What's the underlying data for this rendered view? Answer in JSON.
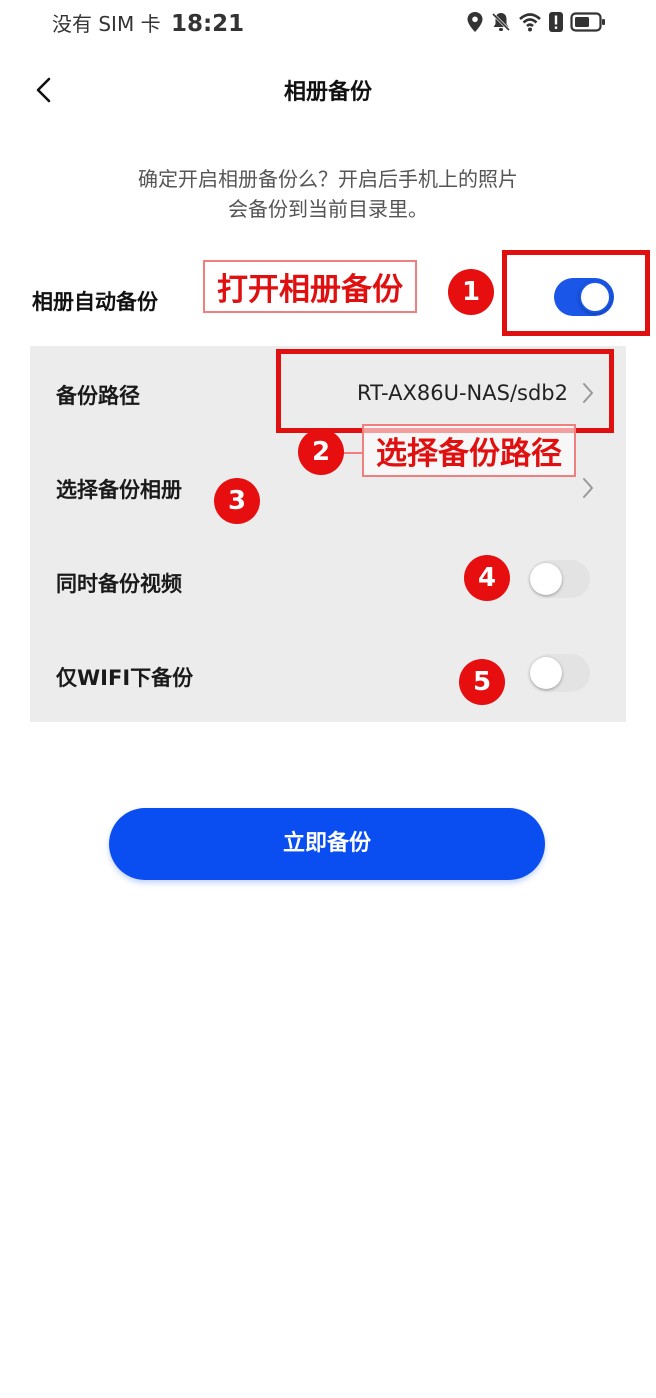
{
  "status_bar": {
    "carrier": "没有 SIM 卡",
    "time": "18:21",
    "icons": [
      "location-icon",
      "bell-muted-icon",
      "wifi-icon",
      "alert-icon",
      "battery-icon"
    ]
  },
  "header": {
    "title": "相册备份",
    "back_icon": "chevron-left-icon"
  },
  "description": {
    "line1": "确定开启相册备份么？开启后手机上的照片",
    "line2": "会备份到当前目录里。"
  },
  "auto_backup": {
    "label": "相册自动备份",
    "enabled": true
  },
  "settings": {
    "backup_path": {
      "label": "备份路径",
      "value": "RT-AX86U-NAS/sdb2"
    },
    "select_album": {
      "label": "选择备份相册"
    },
    "backup_video": {
      "label": "同时备份视频",
      "enabled": false
    },
    "wifi_only": {
      "label": "仅WIFI下备份",
      "enabled": false
    }
  },
  "annotations": {
    "step1_text": "打开相册备份",
    "step2_text": "选择备份路径",
    "numbers": [
      "1",
      "2",
      "3",
      "4",
      "5"
    ],
    "color": "#e01010"
  },
  "primary_button": {
    "label": "立即备份",
    "color": "#0a4ef2"
  },
  "colors": {
    "toggle_on": "#1a57e8",
    "panel_bg": "#ececec"
  }
}
